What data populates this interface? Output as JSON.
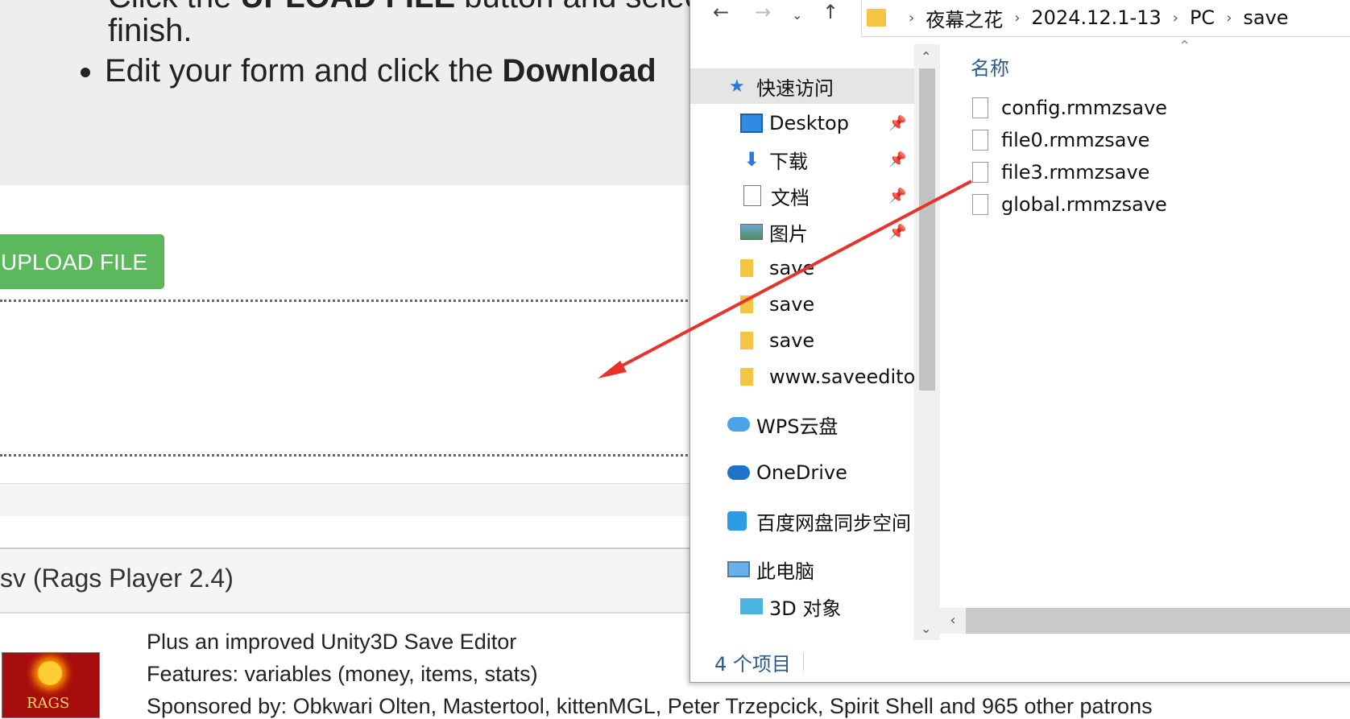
{
  "website": {
    "instructions": {
      "line1_pre": "Click the ",
      "line1_bold": "UPLOAD FILE",
      "line1_post": " button and select",
      "line1_end": "finish.",
      "bullet2_pre": "Edit your form and click the ",
      "bullet2_bold": "Download"
    },
    "upload_button": "UPLOAD FILE",
    "section_title": "sv (Rags Player 2.4)",
    "logo_text": "RAGS",
    "features": [
      "Plus an improved Unity3D Save Editor",
      "Features: variables (money, items, stats)",
      "Sponsored by: Obkwari Olten, Mastertool, kittenMGL, Peter Trzepcick, Spirit Shell and 965 other patrons"
    ]
  },
  "explorer": {
    "address_path": [
      "夜幕之花",
      "2024.12.1-13",
      "PC",
      "save"
    ],
    "nav": {
      "quick_access": "快速访问",
      "items": [
        {
          "label": "Desktop",
          "icon": "desktop-icon",
          "pinned": true
        },
        {
          "label": "下载",
          "icon": "download-icon",
          "pinned": true
        },
        {
          "label": "文档",
          "icon": "document-icon",
          "pinned": true
        },
        {
          "label": "图片",
          "icon": "pictures-icon",
          "pinned": true
        },
        {
          "label": "save",
          "icon": "folder-icon",
          "pinned": false
        },
        {
          "label": "save",
          "icon": "folder-icon",
          "pinned": false
        },
        {
          "label": "save",
          "icon": "folder-icon",
          "pinned": false
        },
        {
          "label": "www.saveeditor",
          "icon": "folder-icon",
          "pinned": false
        }
      ],
      "wps": "WPS云盘",
      "onedrive": "OneDrive",
      "baidu": "百度网盘同步空间",
      "this_pc": "此电脑",
      "objects3d": "3D 对象"
    },
    "column_name": "名称",
    "files": [
      "config.rmmzsave",
      "file0.rmmzsave",
      "file3.rmmzsave",
      "global.rmmzsave"
    ],
    "status": "4 个项目"
  },
  "colors": {
    "upload_green": "#5cb85c",
    "arrow_red": "#e8332a",
    "explorer_blue_text": "#2d5a8a"
  }
}
